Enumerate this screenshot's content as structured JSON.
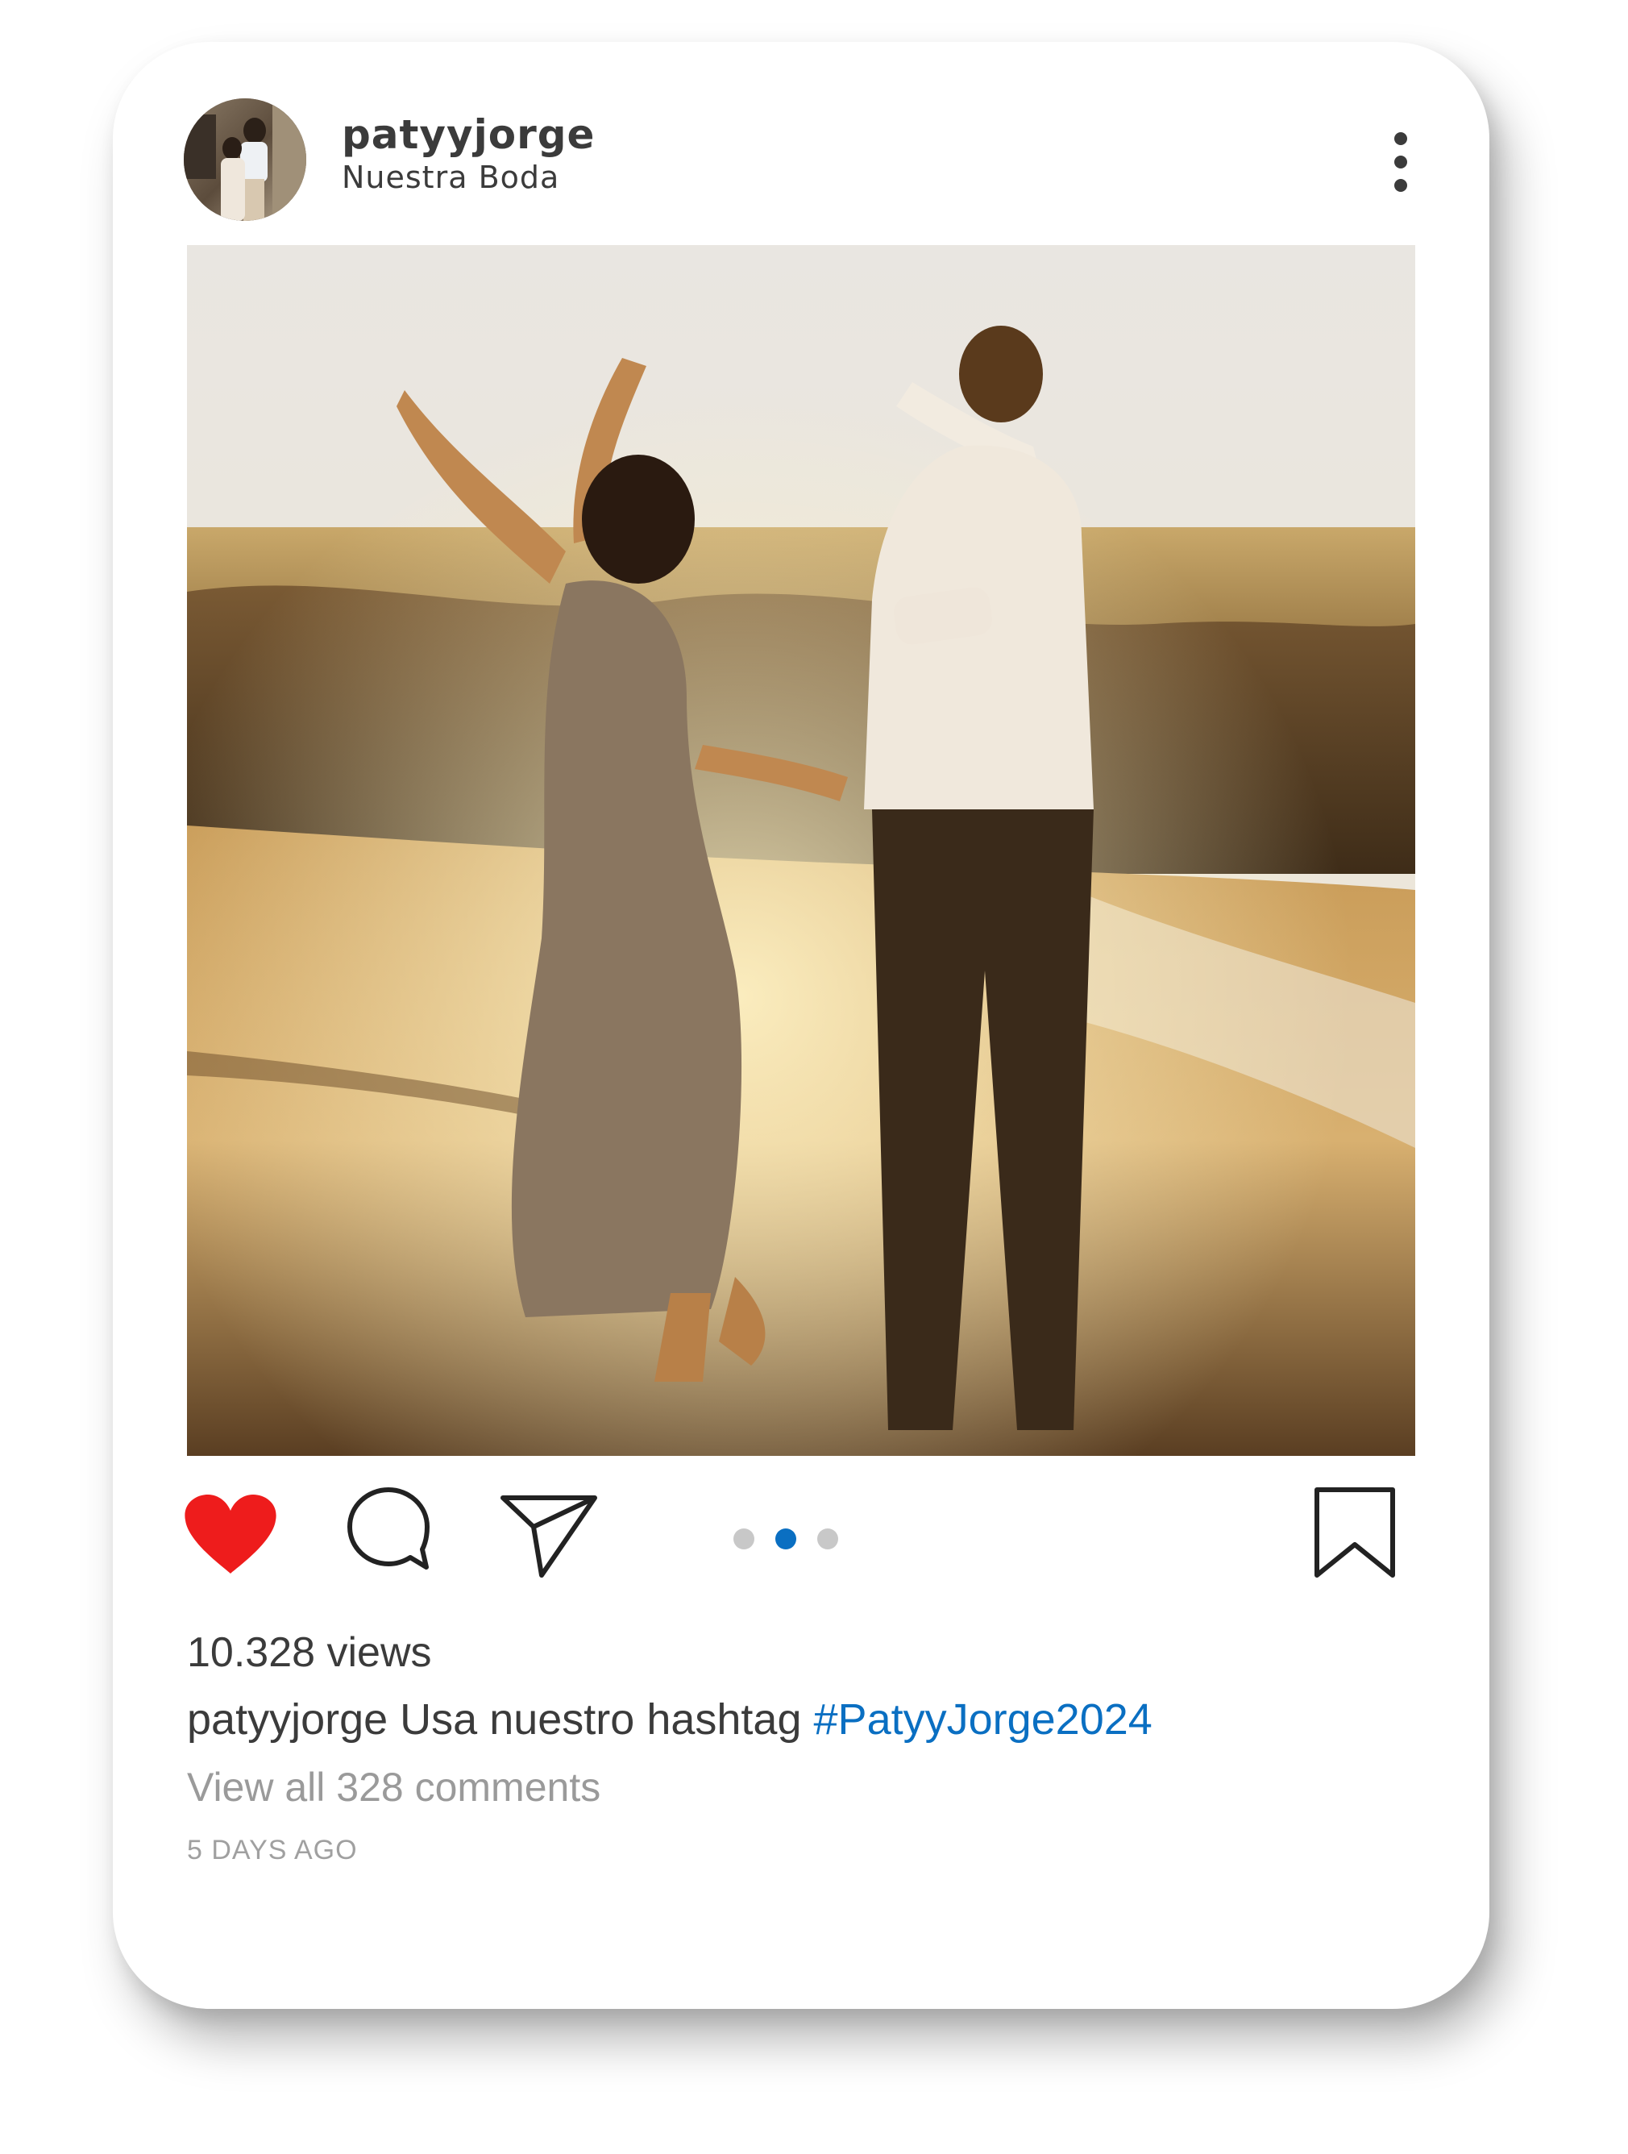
{
  "post": {
    "username": "patyyjorge",
    "location": "Nuestra Boda",
    "views": "10.328 views",
    "caption_user": "patyyjorge",
    "caption_text": "Usa nuestro hashtag",
    "caption_hashtag": "#PatyyJorge2024",
    "view_comments": "View all 328 comments",
    "time_ago": "5 DAYS AGO"
  },
  "carousel": {
    "total": 3,
    "active_index": 1
  },
  "icons": {
    "more": "more-vertical-icon",
    "like": "heart-icon",
    "comment": "comment-bubble-icon",
    "share": "paper-plane-icon",
    "save": "bookmark-icon"
  },
  "colors": {
    "like": "#ee1c1c",
    "hashtag": "#0a6fc2",
    "active_dot": "#0a6fc2",
    "inactive_dot": "#c8c8c8",
    "text": "#3b3b3b",
    "muted": "#9a9a9a"
  }
}
